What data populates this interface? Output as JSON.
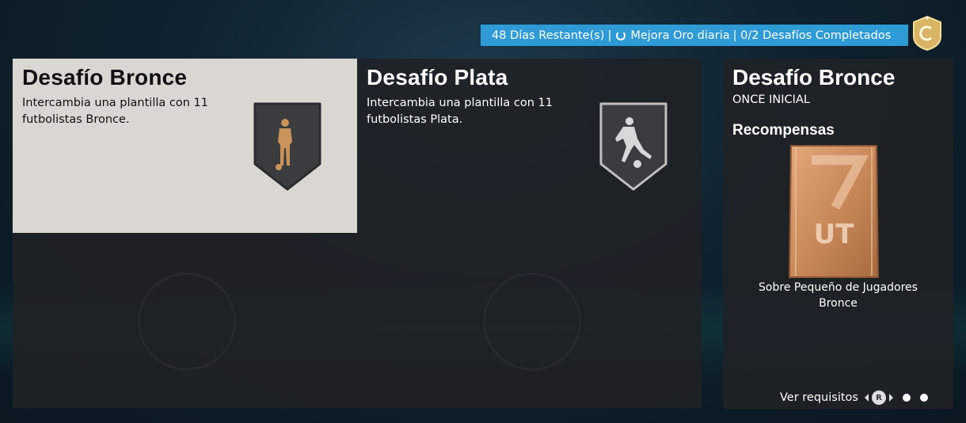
{
  "banner": {
    "days_remaining": "48 Días Restante(s)",
    "separator": "|",
    "upgrade": "Mejora Oro diaria",
    "completed": "| 0/2 Desafíos Completados"
  },
  "challenges": [
    {
      "title": "Desafío Bronce",
      "description": "Intercambia una plantilla con 11 futbolistas Bronce.",
      "icon": "standing-player-icon",
      "color": "#c9935a"
    },
    {
      "title": "Desafío Plata",
      "description": "Intercambia una plantilla con 11 futbolistas Plata.",
      "icon": "dribbling-player-icon",
      "color": "#d0d0d0"
    }
  ],
  "detail": {
    "title": "Desafío Bronce",
    "subtitle": "ONCE INICIAL",
    "rewards_title": "Recompensas",
    "reward_line1": "Sobre Pequeño de Jugadores",
    "reward_line2": "Bronce",
    "pack_logo": "UT"
  },
  "footer": {
    "requirements": "Ver requisitos",
    "button": "R"
  },
  "colors": {
    "banner": "#2f9bd6",
    "selected_card": "#d9d7d2",
    "bronze": "#c9935a"
  }
}
